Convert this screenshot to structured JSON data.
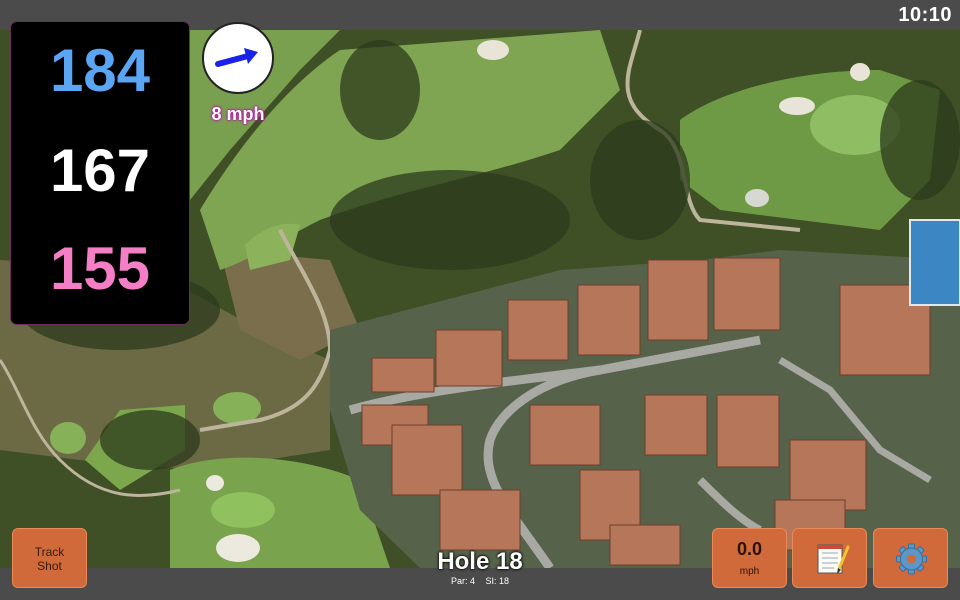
{
  "status": {
    "clock": "10:10"
  },
  "yardages": {
    "back": "184",
    "middle": "167",
    "front": "155"
  },
  "wind": {
    "speed_label": "8 mph",
    "direction_icon": "arrow-icon",
    "arrow_color": "#1a22e8"
  },
  "hole": {
    "title": "Hole 18",
    "par": "Par: 4",
    "stroke_index": "SI: 18"
  },
  "buttons": {
    "track_shot_line1": "Track",
    "track_shot_line2": "Shot",
    "speed_value": "0.0",
    "speed_unit": "mph",
    "notes_icon": "notepad-icon",
    "settings_icon": "gear-icon"
  },
  "colors": {
    "back_yardage": "#5aa6f4",
    "middle_yardage": "#ffffff",
    "front_yardage": "#f57fc6",
    "button": "#d06a3a",
    "bar": "#4b4b4b"
  }
}
